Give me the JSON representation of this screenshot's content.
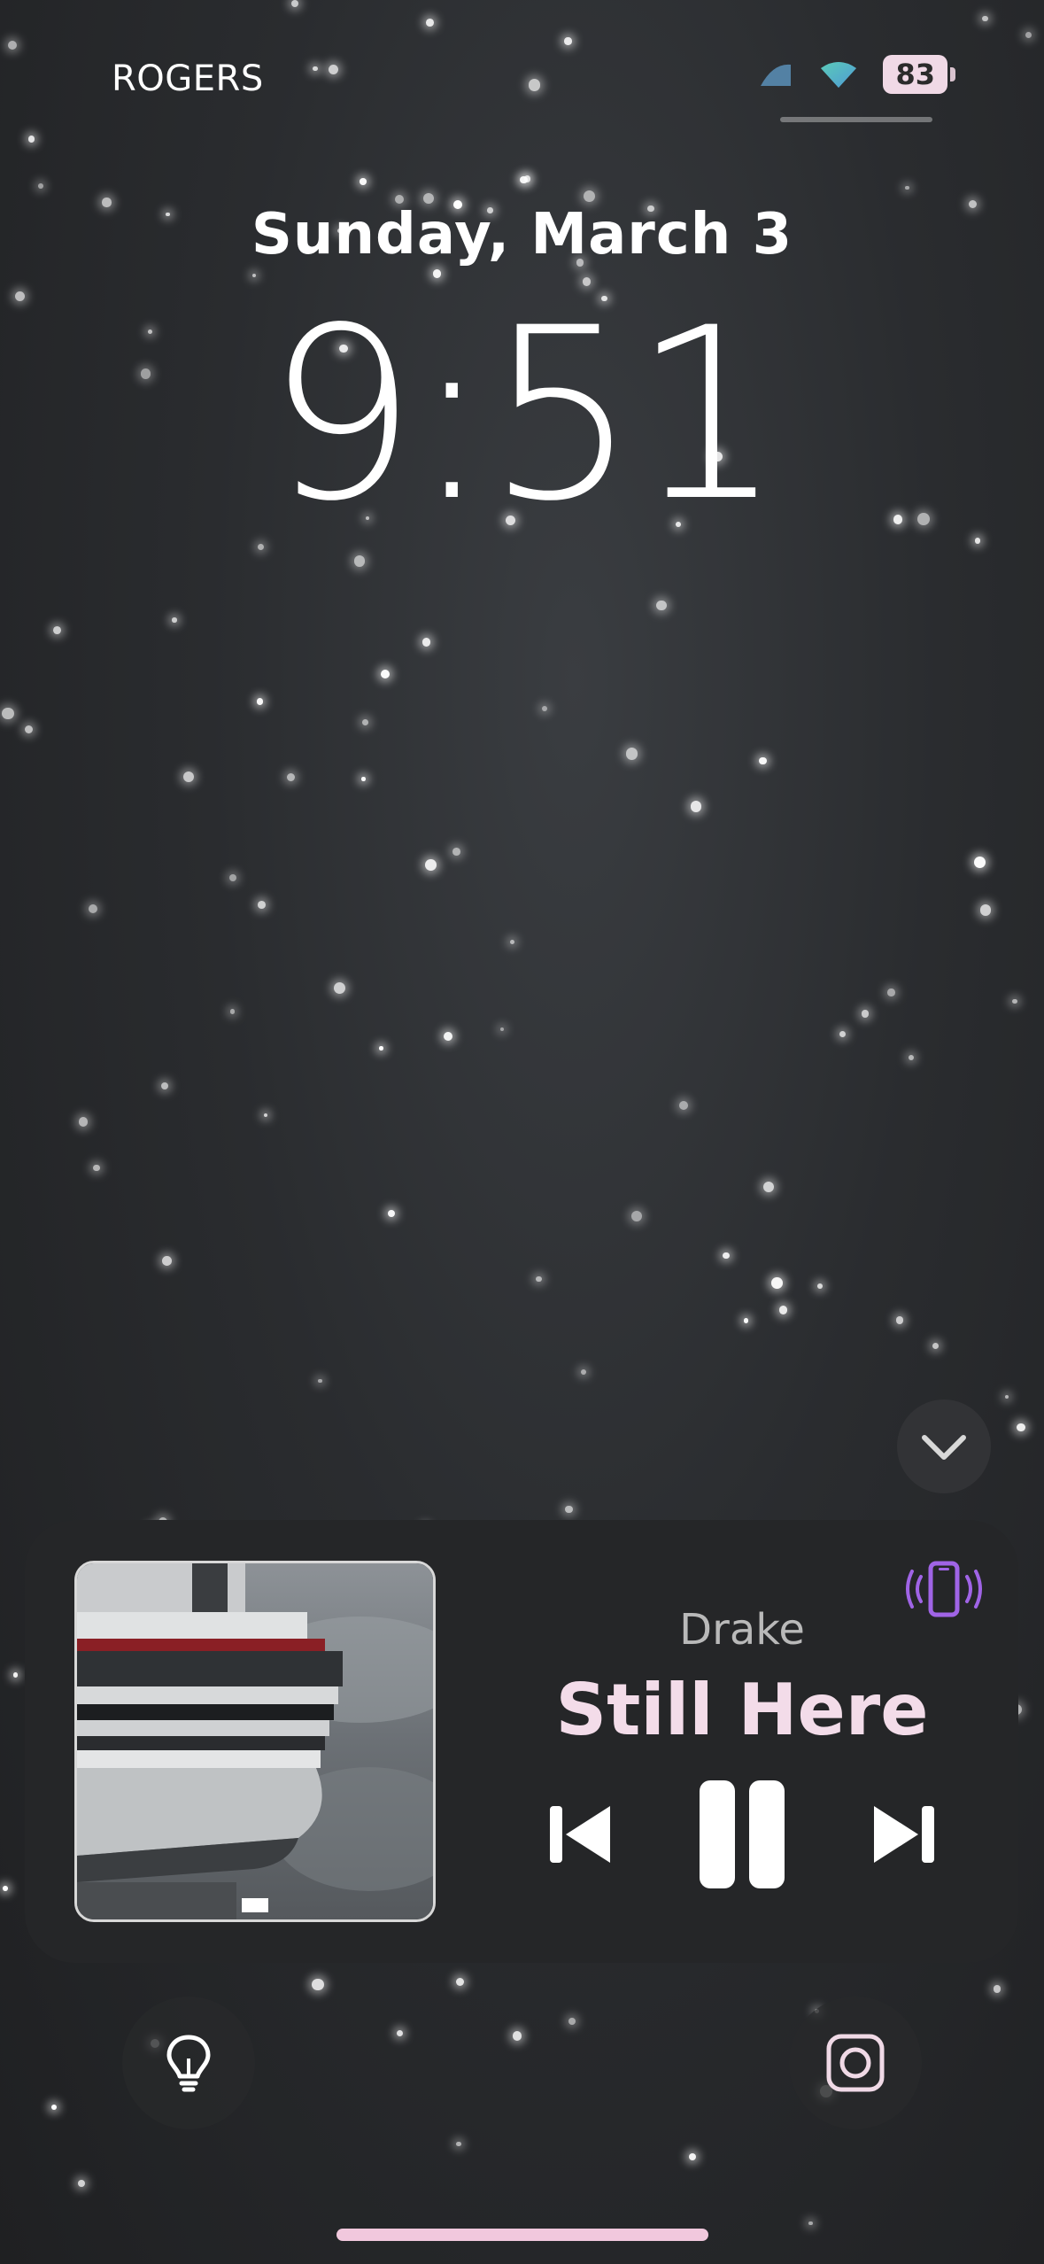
{
  "status_bar": {
    "carrier": "ROGERS",
    "battery": "83",
    "signal_icon": "signal-icon",
    "wifi_icon": "wifi-icon",
    "battery_icon": "battery-icon"
  },
  "lock_screen": {
    "date": "Sunday, March 3",
    "time": "9:51"
  },
  "now_playing": {
    "artist": "Drake",
    "title": "Still Here",
    "album_art": "album-art",
    "output_device_icon": "iphone-vibrate-icon",
    "controls": [
      "previous-track-icon",
      "pause-icon",
      "next-track-icon"
    ],
    "collapse_icon": "chevron-down-icon"
  },
  "quick_actions": {
    "left": "flashlight-icon",
    "right": "camera-icon"
  },
  "colors": {
    "accent_pink": "#f3dce9",
    "device_purple": "#a064e6",
    "home_indicator": "#f1c8dd",
    "battery_fill": "#f0d9e6"
  }
}
